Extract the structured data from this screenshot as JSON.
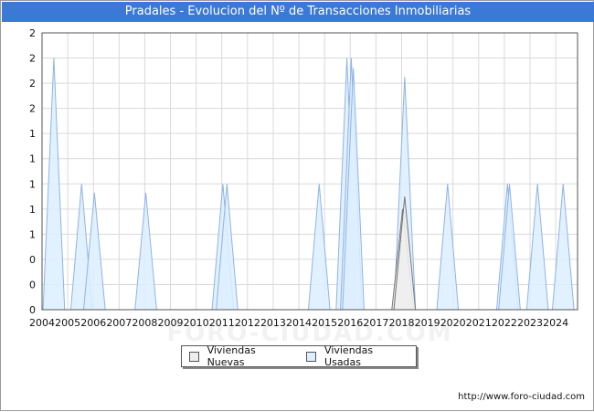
{
  "title": "Pradales - Evolucion del Nº de Transacciones Inmobiliarias",
  "source": "http://www.foro-ciudad.com",
  "watermark": "FORO-CIUDAD.COM",
  "colors": {
    "title_bg": "#3a79d6",
    "nuevas_fill": "#eeeeee",
    "nuevas_stroke": "#777777",
    "usadas_fill": "#ddeeff",
    "usadas_stroke": "#8fb3e6",
    "grid": "#d9d9d9"
  },
  "chart_data": {
    "type": "area",
    "title": "Pradales - Evolucion del Nº de Transacciones Inmobiliarias",
    "xlabel": "",
    "ylabel": "",
    "xlim": [
      2004,
      2024.85
    ],
    "ylim": [
      0,
      2.2
    ],
    "x_ticks": [
      "2004",
      "2005",
      "2006",
      "2007",
      "2008",
      "2009",
      "2010",
      "2011",
      "2012",
      "2013",
      "2014",
      "2015",
      "2016",
      "2017",
      "2018",
      "2019",
      "2020",
      "2021",
      "2022",
      "2023",
      "2024"
    ],
    "y_tick_values": [
      0,
      0.2,
      0.4,
      0.6,
      0.8,
      1.0,
      1.2,
      1.4,
      1.6,
      1.8,
      2.0,
      2.2
    ],
    "y_tick_labels": [
      "0",
      "0",
      "0",
      "1",
      "1",
      "1",
      "1",
      "1",
      "2",
      "2",
      "2",
      "2"
    ],
    "grid": true,
    "legend_position": "bottom",
    "series": [
      {
        "name": "Viviendas Nuevas",
        "peaks": [
          {
            "x": 2018.04,
            "y": 0.8
          },
          {
            "x": 2018.12,
            "y": 0.9
          }
        ]
      },
      {
        "name": "Viviendas Usadas",
        "peaks": [
          {
            "x": 2004.46,
            "y": 2.0
          },
          {
            "x": 2005.54,
            "y": 1.0
          },
          {
            "x": 2006.04,
            "y": 0.93
          },
          {
            "x": 2008.04,
            "y": 0.93
          },
          {
            "x": 2011.04,
            "y": 1.0
          },
          {
            "x": 2011.2,
            "y": 1.0
          },
          {
            "x": 2014.79,
            "y": 1.0
          },
          {
            "x": 2015.87,
            "y": 2.0
          },
          {
            "x": 2016.04,
            "y": 2.0
          },
          {
            "x": 2016.12,
            "y": 1.92
          },
          {
            "x": 2018.12,
            "y": 1.85
          },
          {
            "x": 2019.79,
            "y": 1.0
          },
          {
            "x": 2022.12,
            "y": 1.0
          },
          {
            "x": 2022.2,
            "y": 1.0
          },
          {
            "x": 2023.29,
            "y": 1.0
          },
          {
            "x": 2024.29,
            "y": 1.0
          }
        ]
      }
    ]
  }
}
